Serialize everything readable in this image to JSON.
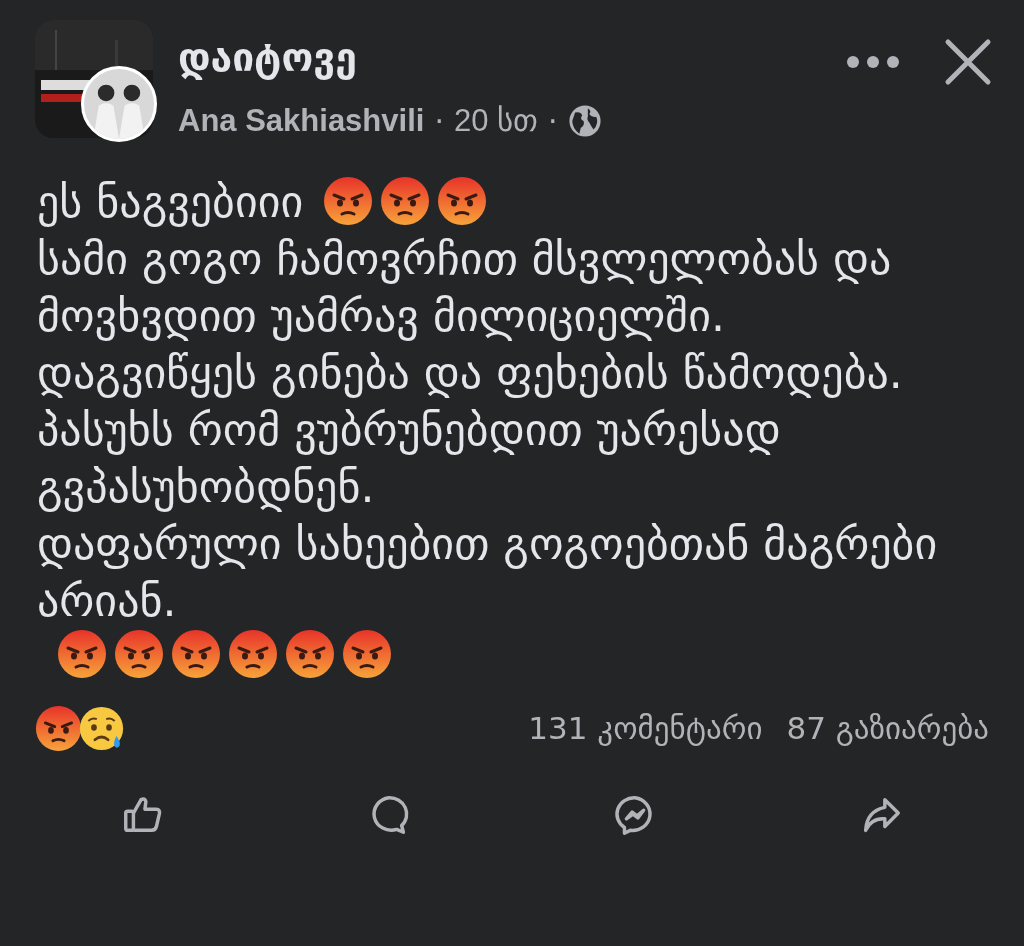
{
  "post": {
    "title": "დაიტოვე",
    "author": "Ana Sakhiashvili",
    "separator_1": "·",
    "time": "20 სთ",
    "separator_2": "·"
  },
  "body": [
    {
      "text": "ეს ნაგვებიიი",
      "emoji": [
        {
          "kind": "angry"
        },
        {
          "kind": "angry"
        },
        {
          "kind": "angry"
        }
      ]
    },
    {
      "text": "სამი გოგო ჩამოვრჩით მსვლელობას და მოვხვდით უამრავ მილიციელში."
    },
    {
      "text": "დაგვიწყეს გინება და ფეხების წამოდება."
    },
    {
      "text": "პასუხს რომ ვუბრუნებდით უარესად გვპასუხობდნენ."
    },
    {
      "text": "დაფარული სახეებით გოგოებთან მაგრები არიან.",
      "emoji": [
        {
          "kind": "angry"
        },
        {
          "kind": "angry"
        },
        {
          "kind": "angry"
        },
        {
          "kind": "angry"
        },
        {
          "kind": "angry"
        },
        {
          "kind": "angry"
        }
      ]
    }
  ],
  "reactions": [
    {
      "kind": "angry"
    },
    {
      "kind": "sad"
    }
  ],
  "comments": "131 კომენტარი",
  "shares": "87 გაზიარება",
  "actions": [
    {
      "kind": "like"
    },
    {
      "kind": "comment"
    },
    {
      "kind": "messenger"
    },
    {
      "kind": "share"
    }
  ]
}
